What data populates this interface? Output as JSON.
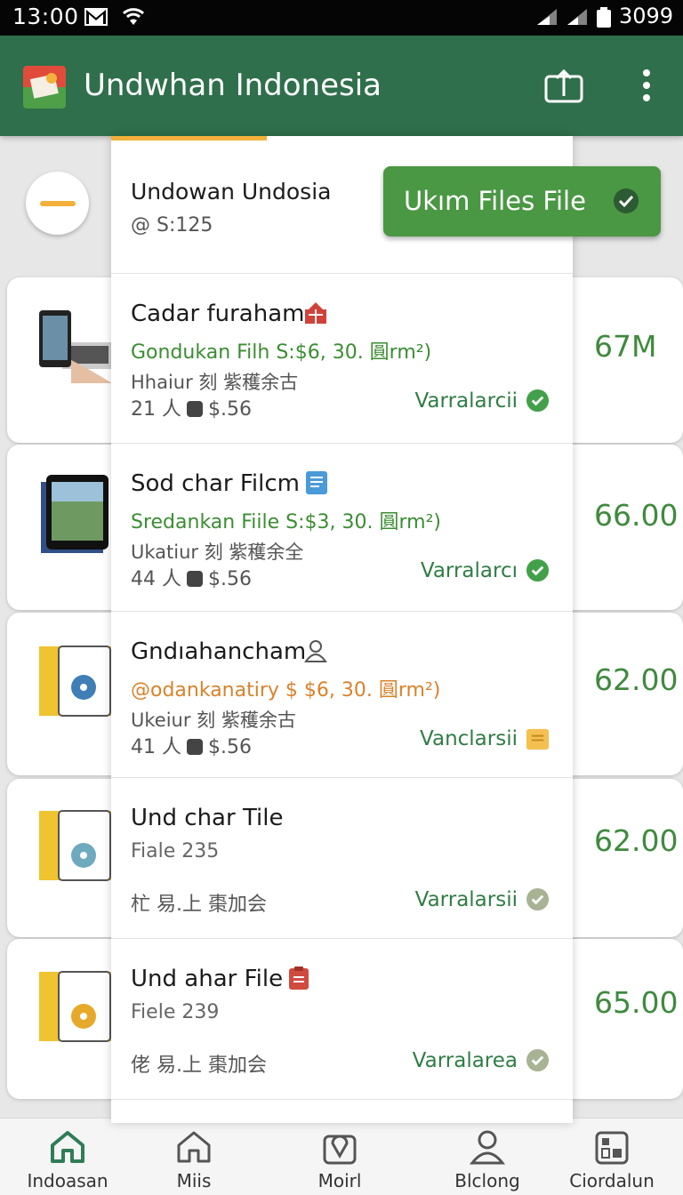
{
  "statusbar": {
    "time": "13:00",
    "battery": "3099"
  },
  "appbar": {
    "title": "Undwhan Indonesia"
  },
  "header": {
    "title": "Undowan Undosia",
    "subtitle": "@ S:125"
  },
  "action_button": {
    "label": "Ukım  Files File"
  },
  "items": [
    {
      "title": "Cadar furaham",
      "subtitle": "Gondukan Filh  S:$6, 30. 圓rm²)",
      "meta": "Hhaiur 刻 紫穫余古",
      "meta2_count": "21 人",
      "meta2_price": "$.56",
      "status": "Varralarcii",
      "price": "67M",
      "subtitle_color": "green",
      "status_icon": "check-circle-icon"
    },
    {
      "title": "Sod char Filcm",
      "subtitle": "Sredankan Fiile S:$3, 30. 圓rm²)",
      "meta": "Ukatiur 刻 紫穫余全",
      "meta2_count": "44 人",
      "meta2_price": "$.56",
      "status": "Varralarcı",
      "price": "66.00",
      "subtitle_color": "green",
      "status_icon": "check-circle-icon"
    },
    {
      "title": "Gndıahancham",
      "subtitle": "@odankanatiry $ $6, 30. 圓rm²)",
      "meta": "Ukeiur 刻 紫穫余古",
      "meta2_count": "41 人",
      "meta2_price": "$.56",
      "status": "Vanclarsii",
      "price": "62.00",
      "subtitle_color": "orange",
      "status_icon": "folder-icon"
    },
    {
      "title": "Und char Tile",
      "subtitle": "Fiale 235",
      "meta": "",
      "meta_cjk": "杧 易.上 棗加会",
      "status": "Varralarsii",
      "price": "62.00",
      "subtitle_color": "gray",
      "status_icon": "check-circle-icon"
    },
    {
      "title": "Und ahar File",
      "subtitle": "Fiele 239",
      "meta": "",
      "meta_cjk": "佬 易.上 棗加会",
      "status": "Varralarea",
      "price": "65.00",
      "subtitle_color": "gray",
      "status_icon": "check-circle-icon"
    }
  ],
  "bottom_nav": [
    {
      "label": "Indoasan",
      "icon": "home-icon",
      "active": true
    },
    {
      "label": "Miis",
      "icon": "home-outline-icon",
      "active": false
    },
    {
      "label": "Moirl",
      "icon": "map-pin-icon",
      "active": false
    },
    {
      "label": "Blclong",
      "icon": "person-icon",
      "active": false
    },
    {
      "label": "Ciordalun",
      "icon": "storefront-icon",
      "active": false
    }
  ],
  "colors": {
    "appbar": "#2f6f4b",
    "accent": "#f3b03a",
    "green": "#3f8a3e",
    "button": "#4a9744"
  }
}
